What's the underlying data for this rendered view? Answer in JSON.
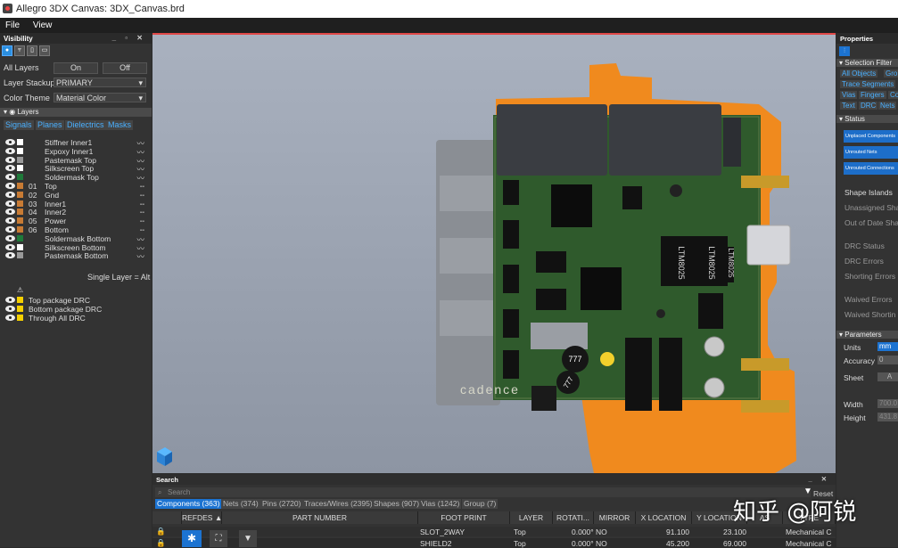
{
  "window": {
    "title": "Allegro 3DX Canvas: 3DX_Canvas.brd"
  },
  "menu": [
    {
      "label": "File"
    },
    {
      "label": "View"
    }
  ],
  "visibility": {
    "title": "Visibility",
    "header_controls": "_ ▫ ✕",
    "all_layers_label": "All Layers",
    "on_label": "On",
    "off_label": "Off",
    "layer_stackup_label": "Layer Stackup",
    "layer_stackup_value": "PRIMARY",
    "color_theme_label": "Color Theme",
    "color_theme_value": "Material Color",
    "layers_section": "Layers",
    "tabs": [
      "Signals",
      "Planes",
      "Dielectrics",
      "Masks"
    ],
    "layers": [
      {
        "num": "",
        "name": "Stiffner Inner1",
        "color": "#ffffff",
        "wave": "〰"
      },
      {
        "num": "",
        "name": "Expoxy Inner1",
        "color": "#ffffff",
        "wave": "〰"
      },
      {
        "num": "",
        "name": "Pastemask Top",
        "color": "#999999",
        "wave": "〰"
      },
      {
        "num": "",
        "name": "Silkscreen Top",
        "color": "#ffffff",
        "wave": "〰"
      },
      {
        "num": "",
        "name": "Soldermask Top",
        "color": "#1f7a3a",
        "wave": "〰"
      },
      {
        "num": "01",
        "name": "Top",
        "color": "#c87b34",
        "wave": "╌"
      },
      {
        "num": "02",
        "name": "Gnd",
        "color": "#c87b34",
        "wave": "╌"
      },
      {
        "num": "03",
        "name": "Inner1",
        "color": "#c87b34",
        "wave": "╌"
      },
      {
        "num": "04",
        "name": "Inner2",
        "color": "#c87b34",
        "wave": "╌"
      },
      {
        "num": "05",
        "name": "Power",
        "color": "#c87b34",
        "wave": "╌"
      },
      {
        "num": "06",
        "name": "Bottom",
        "color": "#c87b34",
        "wave": "╌"
      },
      {
        "num": "",
        "name": "Soldermask Bottom",
        "color": "#1f7a3a",
        "wave": "〰"
      },
      {
        "num": "",
        "name": "Silkscreen Bottom",
        "color": "#ffffff",
        "wave": "〰"
      },
      {
        "num": "",
        "name": "Pastemask Bottom",
        "color": "#999999",
        "wave": "〰"
      }
    ],
    "single_layer_hint": "Single Layer = Alt",
    "drc": [
      {
        "label": "Top package DRC"
      },
      {
        "label": "Bottom package DRC"
      },
      {
        "label": "Through All DRC"
      }
    ]
  },
  "board": {
    "chip_labels": [
      "LTM8025",
      "LTM8025",
      "LTM8025"
    ],
    "knob_labels": [
      "777",
      "777"
    ],
    "silk_text": "cadence"
  },
  "properties": {
    "title": "Properties",
    "selection_filter": "Selection Filter",
    "filter_chips": [
      "All Objects",
      "Gro",
      "Trace Segments",
      "Vias",
      "Fingers",
      "Co",
      "Text",
      "DRC",
      "Nets"
    ],
    "status_section": "Status",
    "status_boxes": [
      "Unplaced Components",
      "Unrouted Nets",
      "Unrouted Connections"
    ],
    "status_rows": [
      "Shape Islands",
      "Unassigned Sha",
      "Out of Date Sha",
      "DRC Status",
      "DRC Errors",
      "Shorting Errors",
      "Waived Errors",
      "Waived Shortin"
    ],
    "parameters_section": "Parameters",
    "units_label": "Units",
    "units_value": "mm",
    "accuracy_label": "Accuracy",
    "accuracy_value": "0",
    "sheet_label": "Sheet",
    "sheet_value": "A",
    "width_label": "Width",
    "width_value": "700.0",
    "height_label": "Height",
    "height_value": "431.8"
  },
  "search": {
    "title": "Search",
    "header_controls": "_ ✕",
    "placeholder": "Search",
    "reset_label": "Reset",
    "tabs": [
      "Components (363)",
      "Nets (374)",
      "Pins (2720)",
      "Traces/Wires (2395)",
      "Shapes (907)",
      "Vias (1242)",
      "Group (7)"
    ],
    "columns": [
      "REFDES ▲",
      "PART NUMBER",
      "FOOT PRINT",
      "LAYER",
      "ROTATI...",
      "MIRROR",
      "X LOCATION",
      "Y LOCATION",
      "AS",
      "TYPE"
    ],
    "rows": [
      {
        "footprint": "SLOT_2WAY",
        "layer": "Top",
        "rotation": "0.000°",
        "mirror": "NO",
        "x": "91.100",
        "y": "23.100",
        "type": "Mechanical C"
      },
      {
        "footprint": "SHIELD2",
        "layer": "Top",
        "rotation": "0.000°",
        "mirror": "NO",
        "x": "45.200",
        "y": "69.000",
        "type": "Mechanical C"
      }
    ]
  },
  "watermark": "知乎 @阿锐",
  "colors": {
    "accent": "#1c73d1",
    "board": "#2f5a2c",
    "flex": "#f08a1e",
    "canvas": "#9aa2b0"
  }
}
